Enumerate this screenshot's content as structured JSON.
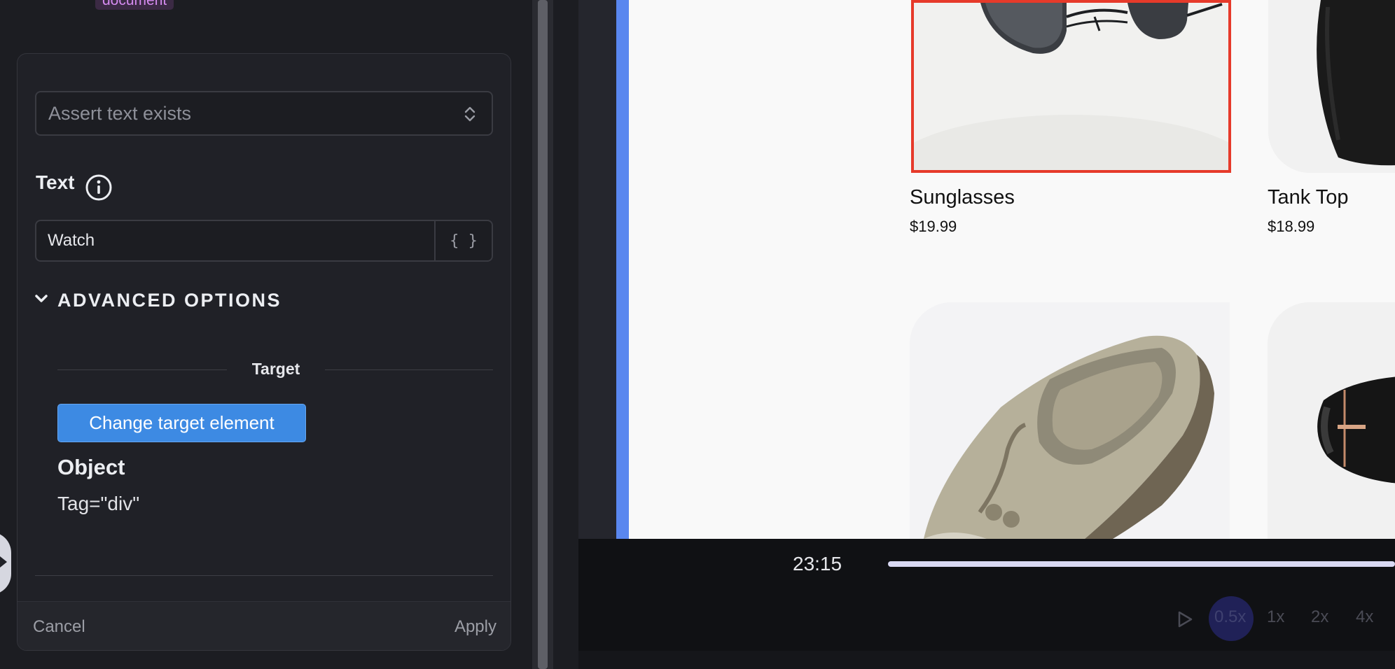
{
  "sidebar": {
    "badge": "document",
    "assertion_select": {
      "value": "Assert text exists"
    },
    "text_field": {
      "label": "Text",
      "value": "Watch",
      "variable_button": "{ }"
    },
    "advanced": {
      "label": "ADVANCED OPTIONS"
    },
    "target": {
      "section_label": "Target",
      "change_button": "Change target element",
      "object_heading": "Object",
      "tag": "Tag=\"div\""
    },
    "footer": {
      "cancel": "Cancel",
      "apply": "Apply"
    }
  },
  "preview": {
    "products": [
      {
        "name": "Sunglasses",
        "price": "$19.99"
      },
      {
        "name": "Tank Top",
        "price": "$18.99"
      }
    ]
  },
  "player": {
    "time": "23:15",
    "speeds": [
      "0.5x",
      "1x",
      "2x",
      "4x"
    ],
    "active_speed": "0.5x"
  },
  "colors": {
    "accent_blue": "#3d8ae3",
    "highlight_red": "#e63a2a",
    "badge_text": "#d58bf0"
  }
}
